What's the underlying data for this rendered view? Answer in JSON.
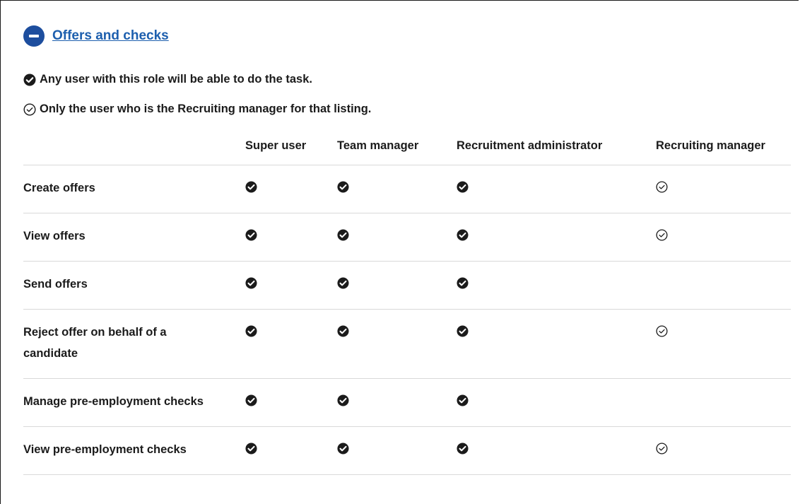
{
  "section": {
    "title": "Offers and checks",
    "toggle_icon": "minus-circle-icon",
    "accent_color": "#1d4e9e",
    "link_color": "#1d5fae"
  },
  "legend": {
    "any_user": {
      "icon": "check-circle-filled-icon",
      "text": "Any user with this role will be able to do the task."
    },
    "only_user": {
      "icon": "check-circle-outline-icon",
      "text": "Only the user who is the Recruiting manager for that listing."
    }
  },
  "table": {
    "columns": [
      "",
      "Super user",
      "Team manager",
      "Recruitment administrator",
      "Recruiting manager"
    ],
    "rows": [
      {
        "task": "Create offers",
        "cells": [
          "filled",
          "filled",
          "filled",
          "outline"
        ]
      },
      {
        "task": "View offers",
        "cells": [
          "filled",
          "filled",
          "filled",
          "outline"
        ]
      },
      {
        "task": "Send offers",
        "cells": [
          "filled",
          "filled",
          "filled",
          ""
        ]
      },
      {
        "task": "Reject offer on behalf of a candidate",
        "cells": [
          "filled",
          "filled",
          "filled",
          "outline"
        ]
      },
      {
        "task": "Manage pre-employment checks",
        "cells": [
          "filled",
          "filled",
          "filled",
          ""
        ]
      },
      {
        "task": "View pre-employment checks",
        "cells": [
          "filled",
          "filled",
          "filled",
          "outline"
        ]
      }
    ]
  }
}
